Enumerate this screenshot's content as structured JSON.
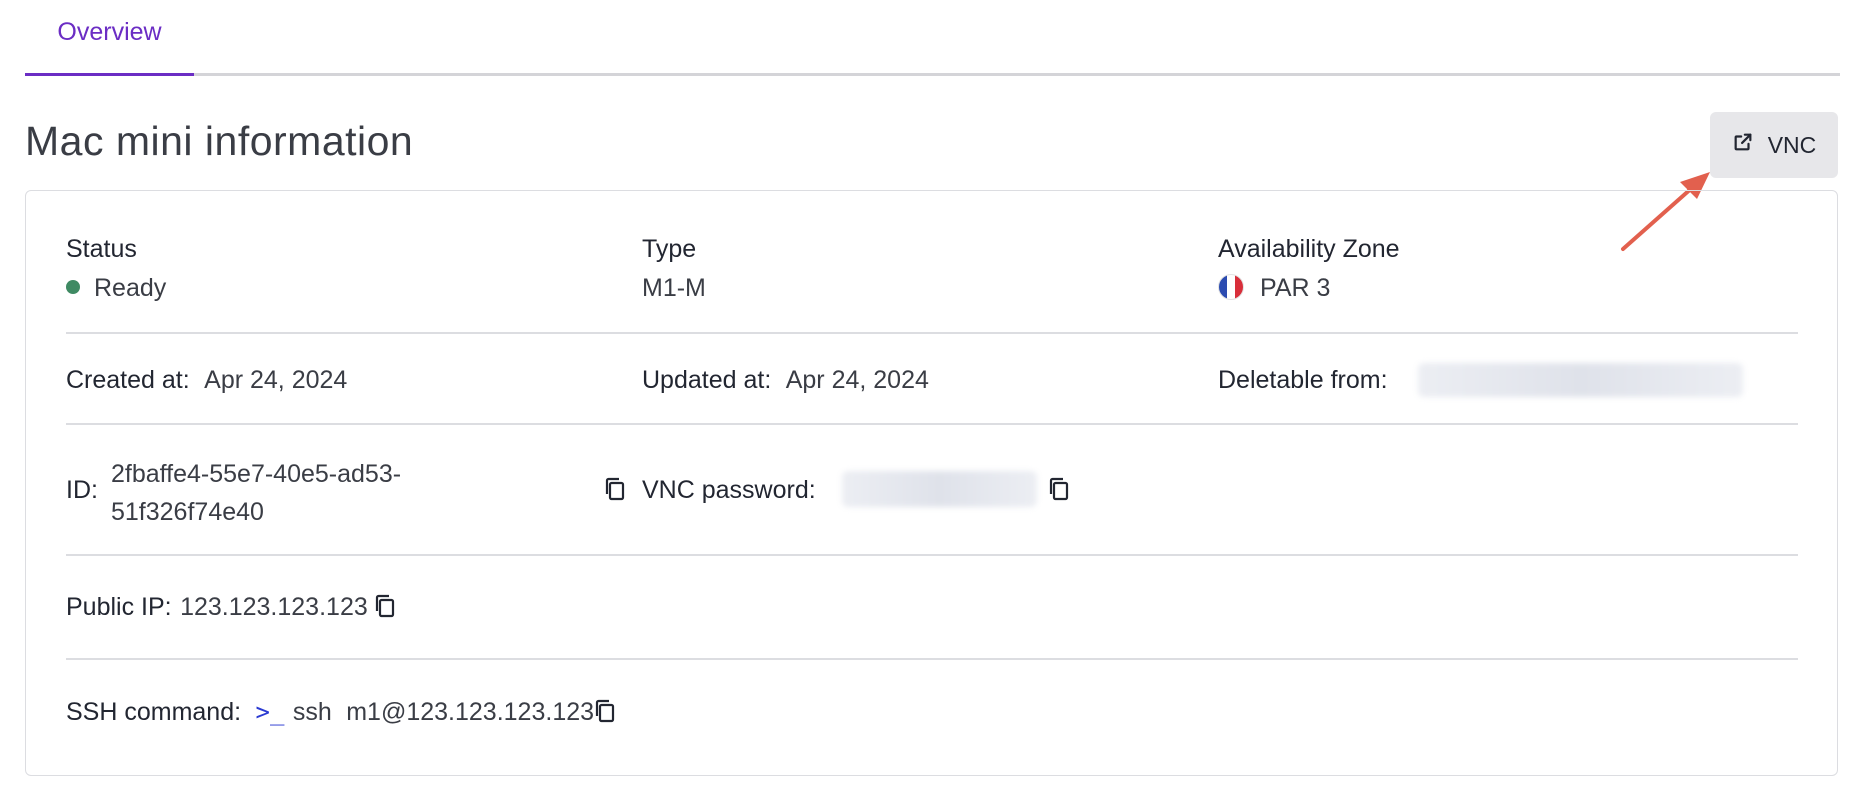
{
  "tabs": [
    {
      "label": "Overview",
      "active": true
    }
  ],
  "title": "Mac mini information",
  "vnc_button": {
    "label": "VNC",
    "icon": "external-link-icon"
  },
  "status": {
    "label": "Status",
    "value": "Ready",
    "color": "#3f8a63"
  },
  "type": {
    "label": "Type",
    "value": "M1-M"
  },
  "zone": {
    "label": "Availability Zone",
    "value": "PAR 3",
    "flag": "france-flag-icon"
  },
  "created": {
    "label": "Created at:",
    "value": "Apr 24, 2024"
  },
  "updated": {
    "label": "Updated at:",
    "value": "Apr 24, 2024"
  },
  "deletable": {
    "label": "Deletable from:"
  },
  "id": {
    "label": "ID:",
    "value_line1": "2fbaffe4-55e7-40e5-ad53-",
    "value_line2": "51f326f74e40"
  },
  "vnc_password": {
    "label": "VNC password:"
  },
  "public_ip": {
    "label": "Public IP:",
    "value": "123.123.123.123"
  },
  "ssh": {
    "label": "SSH command:",
    "prompt": ">_",
    "cmd": "ssh",
    "target": "m1@123.123.123.123"
  },
  "colors": {
    "accent": "#6b2dc4",
    "annotation_arrow": "#e2604e"
  }
}
